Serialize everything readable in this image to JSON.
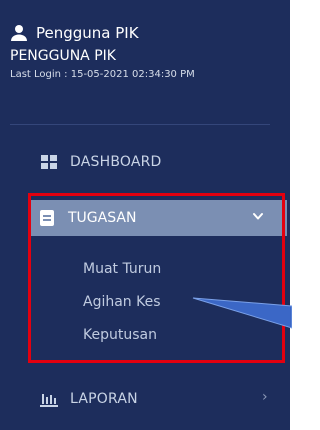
{
  "user": {
    "name": "Pengguna PIK",
    "role": "PENGGUNA PIK",
    "last_login": "Last Login : 15-05-2021 02:34:30 PM"
  },
  "nav": {
    "dashboard": "DASHBOARD",
    "tugasan": "TUGASAN",
    "sub_items": [
      "Muat Turun",
      "Agihan Kes",
      "Keputusan"
    ],
    "laporan": "LAPORAN"
  },
  "colors": {
    "sidebar_bg": "#1d2d5c",
    "active_bg": "#7b8fb3",
    "highlight": "#e3000f",
    "callout": "#3b67c6"
  },
  "icons": [
    "user-icon",
    "grid-icon",
    "document-icon",
    "chevron-down-icon",
    "bar-chart-icon",
    "chevron-right-icon"
  ]
}
